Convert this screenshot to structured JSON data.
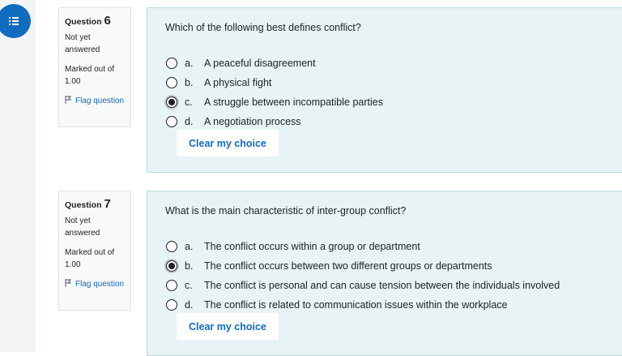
{
  "questions": [
    {
      "label": "Question",
      "number": "6",
      "state": "Not yet answered",
      "grade": "Marked out of 1.00",
      "flag": "Flag question",
      "text": "Which of the following best defines conflict?",
      "answers": [
        {
          "letter": "a.",
          "text": "A peaceful disagreement",
          "checked": false
        },
        {
          "letter": "b.",
          "text": "A physical fight",
          "checked": false
        },
        {
          "letter": "c.",
          "text": "A struggle between incompatible parties",
          "checked": true
        },
        {
          "letter": "d.",
          "text": "A negotiation process",
          "checked": false
        }
      ],
      "clear": "Clear my choice"
    },
    {
      "label": "Question",
      "number": "7",
      "state": "Not yet answered",
      "grade": "Marked out of 1.00",
      "flag": "Flag question",
      "text": "What is the main characteristic of inter-group conflict?",
      "answers": [
        {
          "letter": "a.",
          "text": "The conflict occurs within a group or department",
          "checked": false
        },
        {
          "letter": "b.",
          "text": "The conflict occurs between two different groups or departments",
          "checked": true
        },
        {
          "letter": "c.",
          "text": "The conflict is personal and can cause tension between the individuals involved",
          "checked": false
        },
        {
          "letter": "d.",
          "text": "The conflict is related to communication issues within the workplace",
          "checked": false
        }
      ],
      "clear": "Clear my choice"
    }
  ],
  "icons": {
    "drawer": "hamburger-menu-icon",
    "flag": "flag-icon"
  },
  "colors": {
    "accent": "#0f6cbf",
    "content_bg": "#e7f3f5",
    "info_bg": "#f8f9fa"
  }
}
